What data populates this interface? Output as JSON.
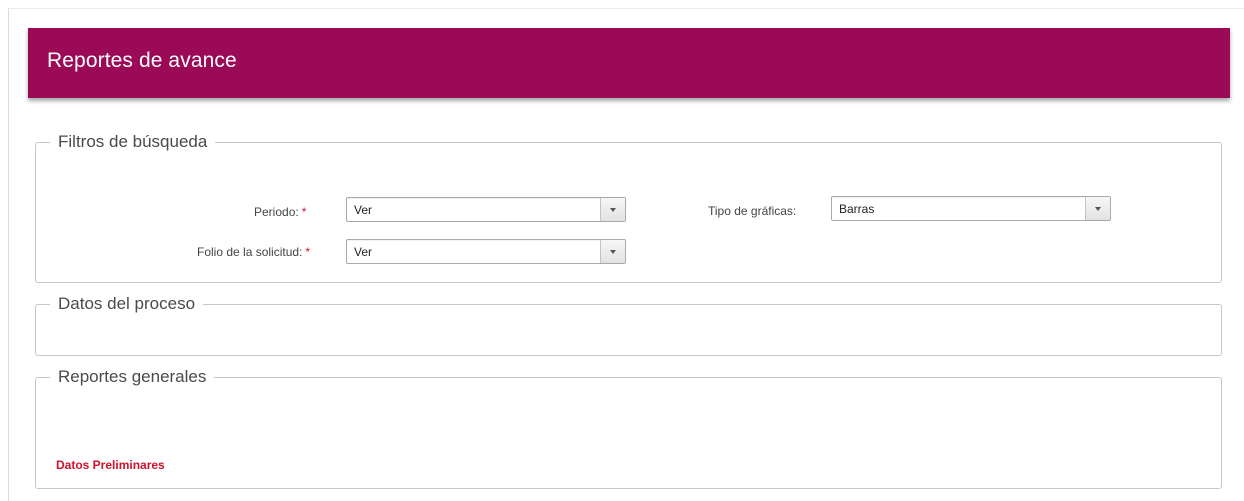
{
  "header": {
    "title": "Reportes de avance"
  },
  "filters": {
    "legend": "Filtros de búsqueda",
    "periodo": {
      "label": "Periodo:",
      "required_mark": "*",
      "value": "Ver"
    },
    "folio": {
      "label": "Folio de la solicitud:",
      "required_mark": "*",
      "value": "Ver"
    },
    "tipo_graficas": {
      "label": "Tipo de gráficas:",
      "value": "Barras"
    }
  },
  "process": {
    "legend": "Datos del proceso"
  },
  "reports": {
    "legend": "Reportes generales",
    "preliminary_note": "Datos Preliminares"
  },
  "colors": {
    "header_background": "#9b0a56",
    "required_marker": "#d0112b",
    "preliminary_text": "#d0112b"
  },
  "icons": {
    "dropdown_arrow": "chevron-down-icon"
  }
}
